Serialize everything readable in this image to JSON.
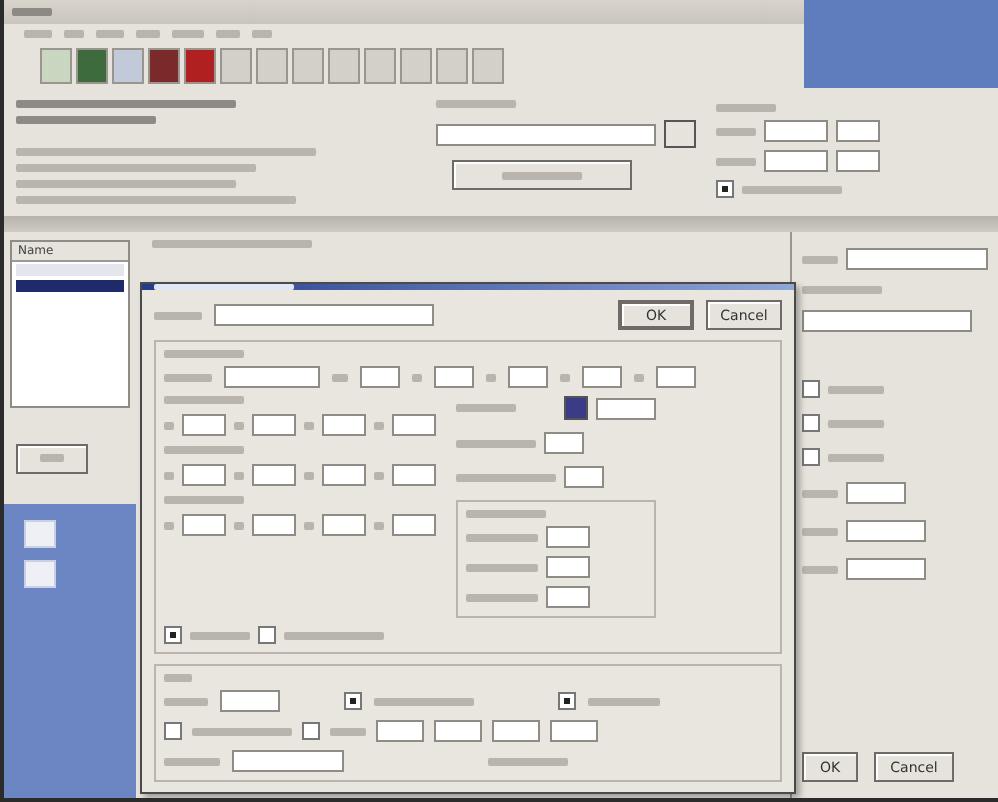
{
  "list": {
    "header": "Name",
    "rows": [
      {
        "selected": false
      },
      {
        "selected": true
      }
    ]
  },
  "top_options": {
    "checkboxes": [
      {
        "checked": true
      }
    ]
  },
  "dialog": {
    "buttons": [
      "OK",
      "Cancel"
    ],
    "checkboxes": [
      {
        "checked": true
      },
      {
        "checked": false
      },
      {
        "checked": false
      },
      {
        "checked": false
      }
    ],
    "radios": [
      {
        "selected": true
      },
      {
        "selected": true
      }
    ]
  },
  "side_panel": {
    "checkboxes": [
      {
        "checked": false
      },
      {
        "checked": false
      },
      {
        "checked": false
      }
    ],
    "buttons": [
      "OK",
      "Cancel"
    ]
  }
}
